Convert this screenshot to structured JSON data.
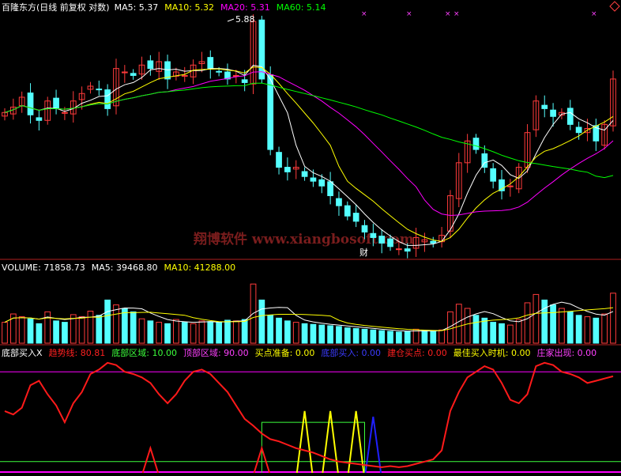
{
  "colors": {
    "bg": "#000000",
    "up": "#ff3b3b",
    "down": "#54ffff",
    "ma5": "#ffffff",
    "ma10": "#ffff00",
    "ma20": "#ff00ff",
    "ma60": "#00ff00",
    "divider": "#b02020",
    "watermark": "#7a1d1d",
    "trend": "#ff1a1a",
    "yellow": "#ffff00",
    "blue": "#2020ff",
    "green": "#3cff3c"
  },
  "price_panel": {
    "title": "百隆东方(日线 前复权 对数)",
    "ma_labels": [
      {
        "text": "MA5: 5.37",
        "color": "#ffffff"
      },
      {
        "text": "MA10: 5.32",
        "color": "#ffff00"
      },
      {
        "text": "MA20: 5.31",
        "color": "#ff00ff"
      },
      {
        "text": "MA60: 5.14",
        "color": "#00ff00"
      }
    ],
    "peak_label": "5.88",
    "low_label": "财",
    "watermark": "翔博软件 www.xiangbosoft.com"
  },
  "volume_panel": {
    "labels": [
      {
        "text": "VOLUME: 71858.73",
        "color": "#ffffff"
      },
      {
        "text": "MA5: 39468.80",
        "color": "#ffffff"
      },
      {
        "text": "MA10: 41288.00",
        "color": "#ffff00"
      }
    ]
  },
  "indicator_panel": {
    "labels": [
      {
        "text": "底部买入X",
        "color": "#ffffff"
      },
      {
        "text": "趋势线: 80.81",
        "color": "#ff2020"
      },
      {
        "text": "底部区域: 10.00",
        "color": "#3cff3c"
      },
      {
        "text": "顶部区域: 90.00",
        "color": "#ff40ff"
      },
      {
        "text": "买点准备: 0.00",
        "color": "#ffff00"
      },
      {
        "text": "底部买入: 0.00",
        "color": "#3b3bff"
      },
      {
        "text": "建仓买点: 0.00",
        "color": "#ff2020"
      },
      {
        "text": "最佳买入时机: 0.00",
        "color": "#ffff00"
      },
      {
        "text": "庄家出现: 0.00",
        "color": "#ff40ff"
      }
    ]
  },
  "chart_data": {
    "type": "candlestick",
    "bars": 72,
    "price_range": [
      3.05,
      6.0
    ],
    "peak_value": 5.88,
    "close": [
      4.55,
      4.62,
      4.75,
      4.52,
      4.45,
      4.7,
      4.6,
      4.55,
      4.7,
      4.8,
      4.9,
      4.85,
      4.6,
      5.15,
      5.1,
      5.05,
      5.2,
      5.15,
      5.25,
      5.0,
      5.1,
      5.05,
      5.2,
      5.25,
      5.15,
      5.1,
      5.0,
      5.05,
      4.95,
      5.88,
      5.0,
      4.1,
      3.9,
      3.85,
      3.9,
      3.8,
      3.75,
      3.7,
      3.6,
      3.5,
      3.4,
      3.35,
      3.25,
      3.2,
      3.15,
      3.12,
      3.1,
      3.08,
      3.2,
      3.18,
      3.15,
      3.22,
      3.6,
      3.95,
      4.2,
      4.1,
      3.9,
      3.75,
      3.65,
      3.7,
      3.9,
      4.3,
      4.7,
      4.6,
      4.5,
      4.55,
      4.4,
      4.3,
      4.35,
      4.2,
      4.4,
      5.0
    ],
    "volume_range": [
      0,
      100000
    ],
    "volume": [
      30000,
      42000,
      38000,
      35000,
      28000,
      45000,
      32000,
      30000,
      41000,
      38000,
      46000,
      40000,
      62000,
      55000,
      50000,
      45000,
      35000,
      32000,
      30000,
      28000,
      34000,
      30000,
      28000,
      32000,
      31000,
      30000,
      33000,
      32000,
      34000,
      85000,
      62000,
      40000,
      36000,
      32000,
      30000,
      28000,
      27000,
      26000,
      25000,
      24000,
      22000,
      21000,
      20000,
      19000,
      18000,
      17000,
      16000,
      16500,
      20000,
      18000,
      17000,
      19000,
      45000,
      56000,
      50000,
      40000,
      36000,
      30000,
      28000,
      26000,
      34000,
      58000,
      70000,
      62000,
      55000,
      50000,
      45000,
      40000,
      38000,
      36000,
      42000,
      71858.73
    ],
    "indicator_range": [
      0,
      100
    ],
    "trend_line": [
      55,
      52,
      58,
      78,
      82,
      70,
      60,
      45,
      62,
      72,
      88,
      92,
      98,
      96,
      90,
      88,
      85,
      80,
      70,
      62,
      70,
      82,
      90,
      92,
      88,
      80,
      72,
      60,
      48,
      42,
      35,
      30,
      28,
      25,
      22,
      20,
      18,
      15,
      12,
      10,
      9,
      8,
      7,
      6,
      5,
      6,
      5,
      6,
      8,
      10,
      12,
      20,
      55,
      72,
      85,
      90,
      95,
      92,
      80,
      65,
      62,
      70,
      95,
      98,
      96,
      90,
      88,
      85,
      80,
      82,
      84,
      86
    ],
    "bottom_zone": 10,
    "top_zone": 90,
    "spikes": [
      {
        "index": 17,
        "height": 22,
        "color": "red"
      },
      {
        "index": 30,
        "height": 22,
        "color": "red"
      },
      {
        "index": 35,
        "height": 55,
        "color": "yellow"
      },
      {
        "index": 38,
        "height": 55,
        "color": "yellow"
      },
      {
        "index": 41,
        "height": 55,
        "color": "yellow"
      },
      {
        "index": 43,
        "height": 50,
        "color": "blue"
      }
    ],
    "step_line": {
      "from": 30,
      "to": 42,
      "value": 45
    }
  }
}
